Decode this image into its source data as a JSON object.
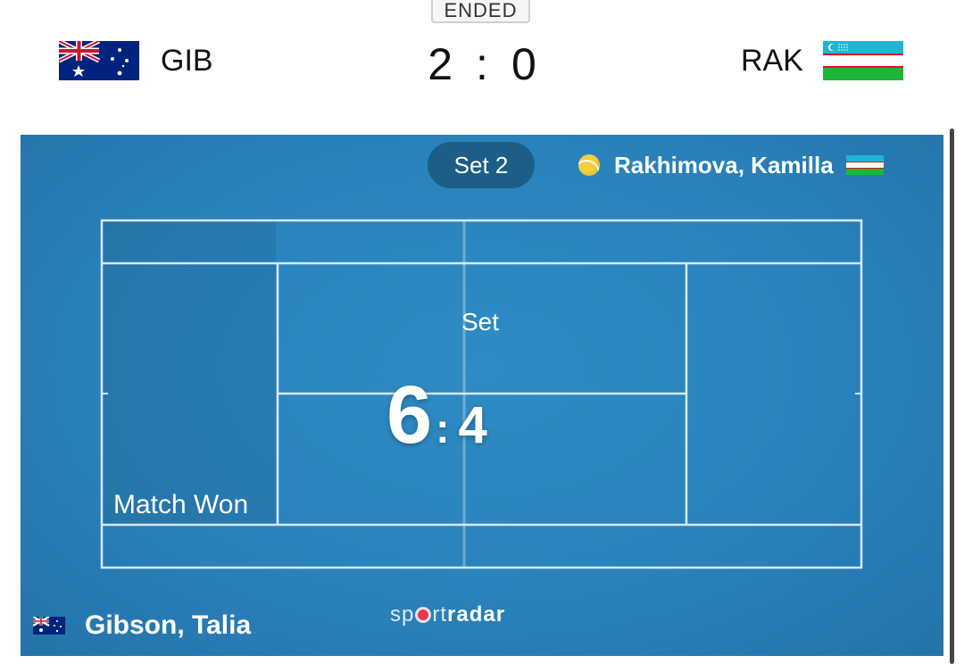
{
  "header": {
    "status": "ENDED",
    "home": {
      "code": "GIB",
      "flag": "australia-flag"
    },
    "away": {
      "code": "RAK",
      "flag": "uzbekistan-flag"
    },
    "score": {
      "home": "2",
      "separator": ":",
      "away": "0"
    }
  },
  "court": {
    "set_pill": "Set 2",
    "server": {
      "name": "Rakhimova, Kamilla",
      "icon": "tennis-ball-icon",
      "flag": "uzbekistan-flag"
    },
    "set_label": "Set",
    "set_score": {
      "home": "6",
      "separator": ":",
      "away": "4"
    },
    "match_won": "Match Won",
    "bottom_player": {
      "name": "Gibson, Talia",
      "flag": "australia-flag"
    },
    "brand": {
      "prefix": "sp",
      "middle": "rt",
      "suffix": "radar"
    }
  },
  "colors": {
    "court": "#2a82bb",
    "pill": "#1c5e86",
    "ball": "#f3cf3c",
    "brand_dot": "#e8384f"
  }
}
